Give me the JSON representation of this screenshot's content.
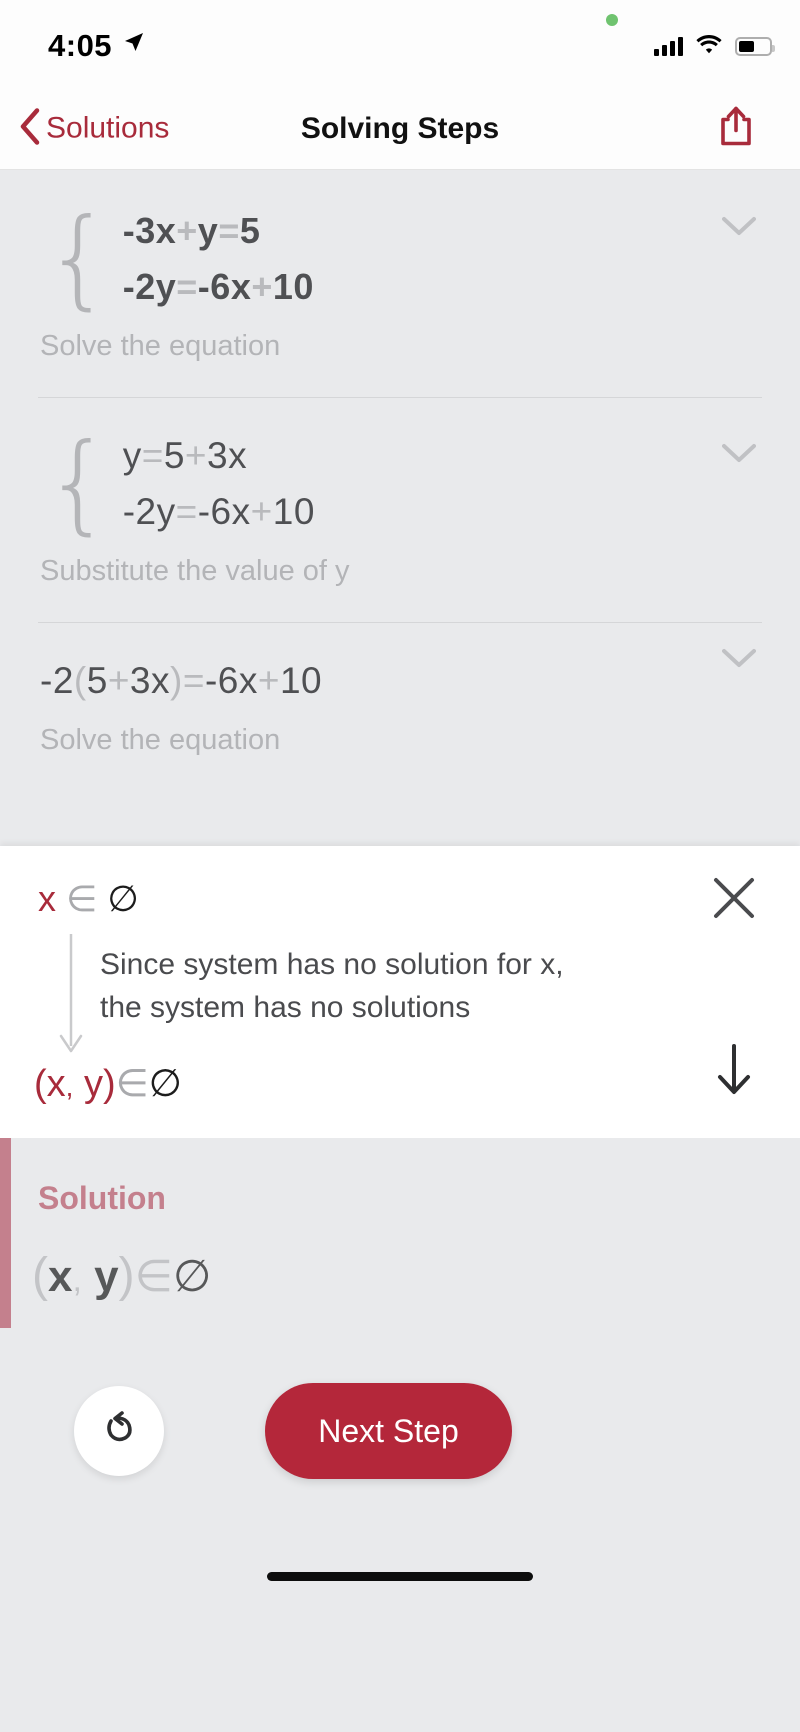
{
  "status_bar": {
    "time": "4:05",
    "location_icon": "location-arrow-icon",
    "signal_icon": "cellular-signal-icon",
    "wifi_icon": "wifi-icon",
    "battery_icon": "battery-icon",
    "recording_dot": "green-privacy-dot"
  },
  "nav": {
    "back_label": "Solutions",
    "title": "Solving Steps",
    "share_icon": "share-icon",
    "back_icon": "chevron-left-icon"
  },
  "steps": [
    {
      "lines": [
        [
          {
            "t": "-3",
            "c": "dark"
          },
          {
            "t": "x",
            "c": "dark"
          },
          {
            "t": "+",
            "c": "op"
          },
          {
            "t": "y",
            "c": "dark"
          },
          {
            "t": "=",
            "c": "op"
          },
          {
            "t": "5",
            "c": "dark"
          }
        ],
        [
          {
            "t": "-2",
            "c": "dark"
          },
          {
            "t": "y",
            "c": "dark"
          },
          {
            "t": "=",
            "c": "op"
          },
          {
            "t": "-6",
            "c": "dark"
          },
          {
            "t": "x",
            "c": "dark"
          },
          {
            "t": "+",
            "c": "op"
          },
          {
            "t": "10",
            "c": "dark"
          }
        ]
      ],
      "plain": "-3x+y=5 ; -2y=-6x+10",
      "caption": "Solve the equation",
      "system": true,
      "bold": true,
      "expand_icon": "chevron-down-icon"
    },
    {
      "lines": [
        [
          {
            "t": "y",
            "c": "dark"
          },
          {
            "t": "=",
            "c": "op"
          },
          {
            "t": "5",
            "c": "dark"
          },
          {
            "t": "+",
            "c": "op"
          },
          {
            "t": "3",
            "c": "dark"
          },
          {
            "t": "x",
            "c": "dark"
          }
        ],
        [
          {
            "t": "-2",
            "c": "dark"
          },
          {
            "t": "y",
            "c": "dark"
          },
          {
            "t": "=",
            "c": "op"
          },
          {
            "t": "-6",
            "c": "dark"
          },
          {
            "t": "x",
            "c": "dark"
          },
          {
            "t": "+",
            "c": "op"
          },
          {
            "t": "10",
            "c": "dark"
          }
        ]
      ],
      "plain": "y=5+3x ; -2y=-6x+10",
      "caption": "Substitute the value of y",
      "system": true,
      "bold": false,
      "expand_icon": "chevron-down-icon"
    },
    {
      "lines": [
        [
          {
            "t": "-2",
            "c": "dark"
          },
          {
            "t": "(",
            "c": "op"
          },
          {
            "t": "5",
            "c": "dark"
          },
          {
            "t": "+",
            "c": "op"
          },
          {
            "t": "3",
            "c": "dark"
          },
          {
            "t": "x",
            "c": "dark"
          },
          {
            "t": ")",
            "c": "op"
          },
          {
            "t": "=",
            "c": "op"
          },
          {
            "t": "-6",
            "c": "dark"
          },
          {
            "t": "x",
            "c": "dark"
          },
          {
            "t": "+",
            "c": "op"
          },
          {
            "t": "10",
            "c": "dark"
          }
        ]
      ],
      "plain": "-2(5+3x)=-6x+10",
      "caption": "Solve the equation",
      "system": false,
      "bold": false,
      "expand_icon": "chevron-down-icon"
    }
  ],
  "card": {
    "top_expression": {
      "variable": "x",
      "member_symbol": "∈",
      "set_symbol": "∅"
    },
    "explanation_line1": "Since system has no solution for x,",
    "explanation_line2": "the system has no solutions",
    "bottom_expression": {
      "open": "(",
      "var1": "x",
      "comma": ",",
      "var2": "y",
      "close": ")",
      "member_symbol": "∈",
      "set_symbol": "∅"
    },
    "close_icon": "close-icon",
    "next_icon": "arrow-down-icon",
    "flow_arrow_icon": "flow-arrow-down-icon"
  },
  "solution": {
    "title": "Solution",
    "open": "(",
    "var1": "x",
    "comma": ",",
    "var2": "y",
    "close": ")",
    "member_symbol": "∈",
    "set_symbol": "∅"
  },
  "actions": {
    "undo_icon": "undo-icon",
    "next_step_label": "Next Step"
  },
  "colors": {
    "brand_red": "#b4273a",
    "nav_red": "#a82b3b",
    "solution_rose": "#c4808d",
    "panel_grey": "#e9eaec",
    "text_dark": "#4f5053",
    "operator_grey": "#b9babd",
    "caption_grey": "#b3b4b7"
  }
}
